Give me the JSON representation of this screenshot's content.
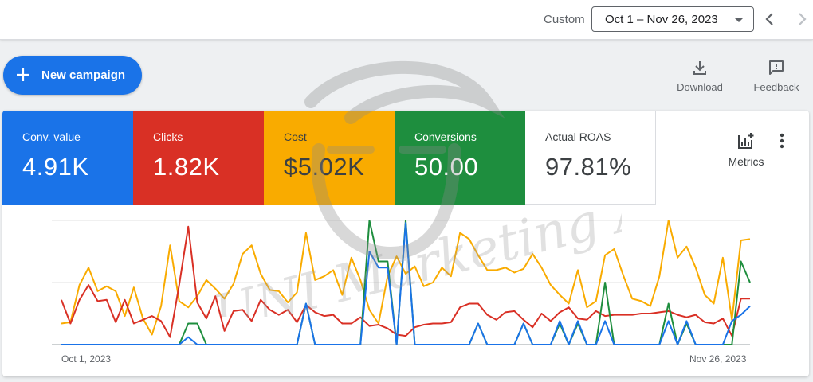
{
  "header": {
    "range_label": "Custom",
    "date_range": "Oct 1 – Nov 26, 2023"
  },
  "toolbar": {
    "new_campaign_label": "New campaign",
    "download_label": "Download",
    "feedback_label": "Feedback"
  },
  "scorecards": [
    {
      "label": "Conv. value",
      "value": "4.91K",
      "color": "#1a73e8"
    },
    {
      "label": "Clicks",
      "value": "1.82K",
      "color": "#d93025"
    },
    {
      "label": "Cost",
      "value": "$5.02K",
      "color": "#f9ab00"
    },
    {
      "label": "Conversions",
      "value": "50.00",
      "color": "#1e8e3e"
    },
    {
      "label": "Actual ROAS",
      "value": "97.81%",
      "color": "#ffffff"
    }
  ],
  "metrics_label": "Metrics",
  "watermark_text": "UNI Marketing Agency",
  "chart_data": {
    "type": "line",
    "x_start_label": "Oct 1, 2023",
    "x_end_label": "Nov 26, 2023",
    "x": [
      "Oct 1, 2023",
      "Nov 26, 2023"
    ],
    "grid": true,
    "series": [
      {
        "metric": "Cost",
        "color": "#f9ab00",
        "values": [
          0.17,
          0.18,
          0.48,
          0.62,
          0.43,
          0.47,
          0.43,
          0.23,
          0.46,
          0.21,
          0.08,
          0.31,
          0.8,
          0.35,
          0.3,
          0.39,
          0.52,
          0.45,
          0.37,
          0.49,
          0.73,
          0.8,
          0.57,
          0.44,
          0.43,
          0.34,
          0.42,
          0.9,
          0.52,
          0.55,
          0.6,
          0.4,
          0.7,
          0.52,
          0.28,
          0.17,
          0.55,
          0.71,
          0.57,
          0.63,
          0.47,
          0.5,
          0.62,
          0.55,
          0.9,
          0.85,
          0.72,
          0.6,
          0.6,
          0.62,
          0.58,
          0.61,
          0.73,
          0.62,
          0.48,
          0.4,
          0.33,
          0.6,
          0.3,
          0.35,
          0.72,
          0.77,
          0.56,
          0.37,
          0.35,
          0.31,
          0.55,
          1.0,
          0.7,
          0.79,
          0.62,
          0.4,
          0.33,
          0.7,
          0.2,
          0.84,
          0.85
        ]
      },
      {
        "metric": "Clicks",
        "color": "#d93025",
        "values": [
          0.36,
          0.17,
          0.36,
          0.48,
          0.35,
          0.36,
          0.18,
          0.36,
          0.17,
          0.2,
          0.23,
          0.19,
          0.06,
          0.48,
          0.95,
          0.34,
          0.21,
          0.39,
          0.11,
          0.27,
          0.28,
          0.19,
          0.36,
          0.28,
          0.24,
          0.28,
          0.18,
          0.32,
          0.26,
          0.23,
          0.24,
          0.17,
          0.17,
          0.22,
          0.15,
          0.16,
          0.13,
          0.08,
          0.07,
          0.14,
          0.16,
          0.17,
          0.17,
          0.18,
          0.3,
          0.33,
          0.33,
          0.24,
          0.2,
          0.26,
          0.27,
          0.2,
          0.14,
          0.25,
          0.19,
          0.26,
          0.3,
          0.21,
          0.2,
          0.27,
          0.23,
          0.24,
          0.24,
          0.24,
          0.25,
          0.25,
          0.26,
          0.27,
          0.24,
          0.22,
          0.24,
          0.18,
          0.17,
          0.21,
          0.07,
          0.37,
          0.37
        ]
      },
      {
        "metric": "Conversions",
        "color": "#1e8e3e",
        "values": [
          0,
          0,
          0,
          0,
          0,
          0,
          0,
          0,
          0,
          0,
          0,
          0,
          0,
          0,
          0.17,
          0.17,
          0,
          0,
          0,
          0,
          0,
          0,
          0,
          0,
          0,
          0,
          0,
          0.33,
          0,
          0,
          0,
          0,
          0,
          0,
          1.0,
          0.67,
          0.67,
          0,
          1.0,
          0,
          0,
          0,
          0,
          0,
          0,
          0,
          0.17,
          0,
          0,
          0,
          0,
          0.17,
          0,
          0,
          0,
          0.17,
          0,
          0.17,
          0,
          0,
          0.5,
          0,
          0,
          0,
          0,
          0,
          0,
          0.33,
          0,
          0.17,
          0,
          0,
          0,
          0,
          0,
          0.67,
          0.5
        ]
      },
      {
        "metric": "Conv. value",
        "color": "#1a73e8",
        "values": [
          0,
          0,
          0,
          0,
          0,
          0,
          0,
          0,
          0,
          0,
          0,
          0,
          0,
          0,
          0.06,
          0,
          0,
          0,
          0,
          0,
          0,
          0,
          0,
          0,
          0,
          0,
          0,
          0.33,
          0,
          0,
          0,
          0,
          0,
          0,
          0.75,
          0.62,
          0.62,
          0,
          0.98,
          0,
          0,
          0,
          0,
          0,
          0,
          0,
          0.17,
          0,
          0,
          0,
          0,
          0.17,
          0,
          0,
          0,
          0.19,
          0,
          0.19,
          0,
          0,
          0.19,
          0,
          0,
          0,
          0,
          0,
          0,
          0.19,
          0,
          0.19,
          0,
          0,
          0,
          0,
          0.19,
          0.24,
          0.31
        ]
      }
    ]
  }
}
